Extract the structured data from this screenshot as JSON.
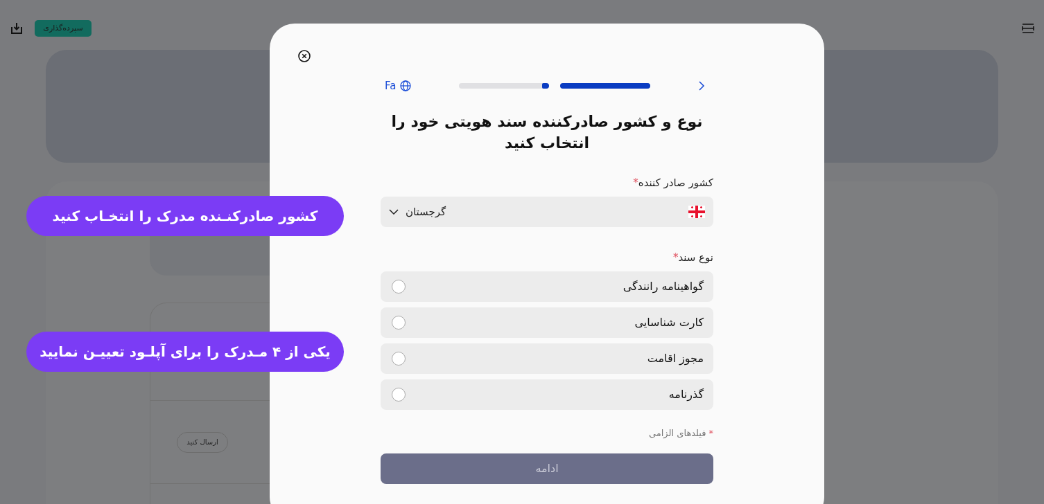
{
  "top_bar": {
    "deposit_button": "سپرده‌گذاری"
  },
  "background": {
    "send_button": "ارسال کنید"
  },
  "callouts": [
    {
      "text": "کشور صادرکنـنده مدرک را انتخـاب کنید"
    },
    {
      "text": "یکی از ۴ مـدرک را برای آپلـود تعییـن نمایید"
    }
  ],
  "modal": {
    "language": "Fa",
    "progress": [
      {
        "level": 1
      },
      {
        "level": 0.08
      }
    ],
    "title": "نوع و کشور صادرکننده سند هویتی خود را انتخاب کنید",
    "country_field": {
      "label": "کشور صادر کننده",
      "required_mark": "*",
      "value": "گرجستان"
    },
    "document_type": {
      "label": "نوع سند",
      "required_mark": "*",
      "options": [
        {
          "label": "گواهینامه رانندگی",
          "selected": false
        },
        {
          "label": "کارت شناسایی",
          "selected": false
        },
        {
          "label": "مجوز اقامت",
          "selected": false
        },
        {
          "label": "گذرنامه",
          "selected": false
        }
      ]
    },
    "required_note": {
      "mark": "*",
      "text": "فیلدهای الزامی"
    },
    "continue_button": {
      "label": "ادامه",
      "disabled": true
    }
  }
}
